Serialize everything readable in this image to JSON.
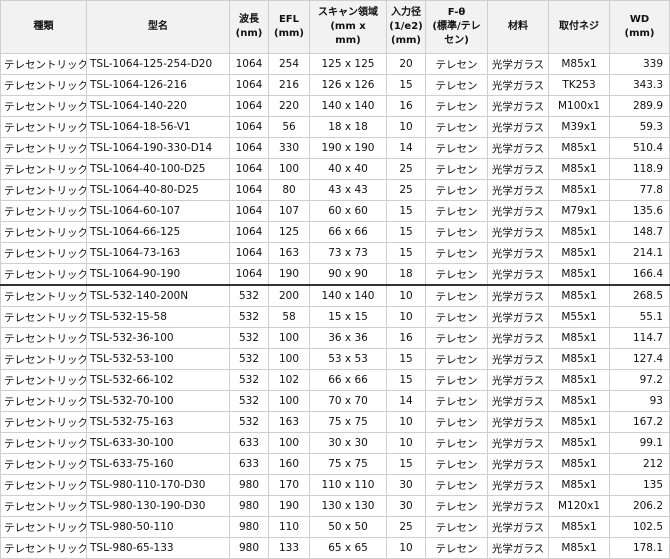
{
  "columns": [
    "種類",
    "型名",
    "波長\n(nm)",
    "EFL\n(mm)",
    "スキャン領域\n(mm x\nmm)",
    "入力径\n(1/e2)\n(mm)",
    "F-θ\n(標準/テレ\nセン)",
    "材料",
    "取付ネジ",
    "WD\n(mm)"
  ],
  "rows": [
    [
      "テレセントリック",
      "TSL-1064-125-254-D20",
      "1064",
      "254",
      "125 x 125",
      "20",
      "テレセン",
      "光学ガラス",
      "M85x1",
      "339"
    ],
    [
      "テレセントリック",
      "TSL-1064-126-216",
      "1064",
      "216",
      "126 x 126",
      "15",
      "テレセン",
      "光学ガラス",
      "TK253",
      "343.3"
    ],
    [
      "テレセントリック",
      "TSL-1064-140-220",
      "1064",
      "220",
      "140 x 140",
      "16",
      "テレセン",
      "光学ガラス",
      "M100x1",
      "289.9"
    ],
    [
      "テレセントリック",
      "TSL-1064-18-56-V1",
      "1064",
      "56",
      "18 x 18",
      "10",
      "テレセン",
      "光学ガラス",
      "M39x1",
      "59.3"
    ],
    [
      "テレセントリック",
      "TSL-1064-190-330-D14",
      "1064",
      "330",
      "190 x 190",
      "14",
      "テレセン",
      "光学ガラス",
      "M85x1",
      "510.4"
    ],
    [
      "テレセントリック",
      "TSL-1064-40-100-D25",
      "1064",
      "100",
      "40 x 40",
      "25",
      "テレセン",
      "光学ガラス",
      "M85x1",
      "118.9"
    ],
    [
      "テレセントリック",
      "TSL-1064-40-80-D25",
      "1064",
      "80",
      "43 x 43",
      "25",
      "テレセン",
      "光学ガラス",
      "M85x1",
      "77.8"
    ],
    [
      "テレセントリック",
      "TSL-1064-60-107",
      "1064",
      "107",
      "60 x 60",
      "15",
      "テレセン",
      "光学ガラス",
      "M79x1",
      "135.6"
    ],
    [
      "テレセントリック",
      "TSL-1064-66-125",
      "1064",
      "125",
      "66 x 66",
      "15",
      "テレセン",
      "光学ガラス",
      "M85x1",
      "148.7"
    ],
    [
      "テレセントリック",
      "TSL-1064-73-163",
      "1064",
      "163",
      "73 x 73",
      "15",
      "テレセン",
      "光学ガラス",
      "M85x1",
      "214.1"
    ],
    [
      "テレセントリック",
      "TSL-1064-90-190",
      "1064",
      "190",
      "90 x 90",
      "18",
      "テレセン",
      "光学ガラス",
      "M85x1",
      "166.4"
    ],
    [
      "テレセントリック",
      "TSL-532-140-200N",
      "532",
      "200",
      "140 x 140",
      "10",
      "テレセン",
      "光学ガラス",
      "M85x1",
      "268.5"
    ],
    [
      "テレセントリック",
      "TSL-532-15-58",
      "532",
      "58",
      "15 x 15",
      "10",
      "テレセン",
      "光学ガラス",
      "M55x1",
      "55.1"
    ],
    [
      "テレセントリック",
      "TSL-532-36-100",
      "532",
      "100",
      "36 x 36",
      "16",
      "テレセン",
      "光学ガラス",
      "M85x1",
      "114.7"
    ],
    [
      "テレセントリック",
      "TSL-532-53-100",
      "532",
      "100",
      "53 x 53",
      "15",
      "テレセン",
      "光学ガラス",
      "M85x1",
      "127.4"
    ],
    [
      "テレセントリック",
      "TSL-532-66-102",
      "532",
      "102",
      "66 x 66",
      "15",
      "テレセン",
      "光学ガラス",
      "M85x1",
      "97.2"
    ],
    [
      "テレセントリック",
      "TSL-532-70-100",
      "532",
      "100",
      "70 x 70",
      "14",
      "テレセン",
      "光学ガラス",
      "M85x1",
      "93"
    ],
    [
      "テレセントリック",
      "TSL-532-75-163",
      "532",
      "163",
      "75 x 75",
      "10",
      "テレセン",
      "光学ガラス",
      "M85x1",
      "167.2"
    ],
    [
      "テレセントリック",
      "TSL-633-30-100",
      "633",
      "100",
      "30 x 30",
      "10",
      "テレセン",
      "光学ガラス",
      "M85x1",
      "99.1"
    ],
    [
      "テレセントリック",
      "TSL-633-75-160",
      "633",
      "160",
      "75 x 75",
      "15",
      "テレセン",
      "光学ガラス",
      "M85x1",
      "212"
    ],
    [
      "テレセントリック",
      "TSL-980-110-170-D30",
      "980",
      "170",
      "110 x 110",
      "30",
      "テレセン",
      "光学ガラス",
      "M85x1",
      "135"
    ],
    [
      "テレセントリック",
      "TSL-980-130-190-D30",
      "980",
      "190",
      "130 x 130",
      "30",
      "テレセン",
      "光学ガラス",
      "M120x1",
      "206.2"
    ],
    [
      "テレセントリック",
      "TSL-980-50-110",
      "980",
      "110",
      "50 x 50",
      "25",
      "テレセン",
      "光学ガラス",
      "M85x1",
      "102.5"
    ],
    [
      "テレセントリック",
      "TSL-980-65-133",
      "980",
      "133",
      "65 x 65",
      "10",
      "テレセン",
      "光学ガラス",
      "M85x1",
      "178.1"
    ]
  ]
}
